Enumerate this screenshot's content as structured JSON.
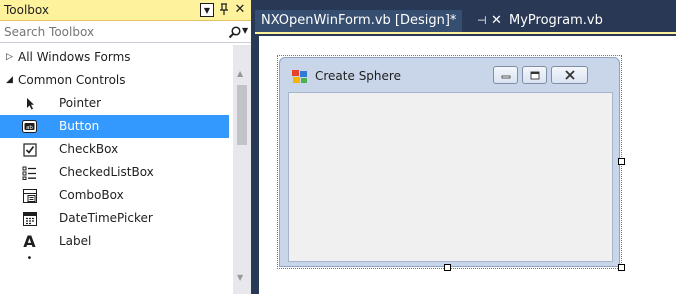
{
  "toolbox": {
    "title": "Toolbox",
    "dropdown_glyph": "▼",
    "pin_glyph": "ᆗ",
    "close_glyph": "✕",
    "search_placeholder": "Search Toolbox",
    "groups": [
      {
        "label": "All Windows Forms",
        "expanded": false,
        "arrow": "▷"
      },
      {
        "label": "Common Controls",
        "expanded": true,
        "arrow": "◢"
      }
    ],
    "items": [
      {
        "label": "Pointer",
        "icon": "pointer-icon",
        "selected": false
      },
      {
        "label": "Button",
        "icon": "button-icon",
        "selected": true
      },
      {
        "label": "CheckBox",
        "icon": "checkbox-icon",
        "selected": false
      },
      {
        "label": "CheckedListBox",
        "icon": "checkedlistbox-icon",
        "selected": false
      },
      {
        "label": "ComboBox",
        "icon": "combobox-icon",
        "selected": false
      },
      {
        "label": "DateTimePicker",
        "icon": "datetimepicker-icon",
        "selected": false
      },
      {
        "label": "Label",
        "icon": "label-icon",
        "selected": false
      }
    ]
  },
  "tabs": [
    {
      "label": "NXOpenWinForm.vb [Design]*",
      "active": true
    },
    {
      "label": "MyProgram.vb",
      "active": false
    }
  ],
  "tab_pin_glyph": "⊣",
  "tab_close_glyph": "✕",
  "form": {
    "title": "Create Sphere"
  },
  "colors": {
    "ide_background": "#293955",
    "toolbox_title": "#fff29d",
    "selection": "#3399ff",
    "form_frame": "#c9d6ea"
  }
}
